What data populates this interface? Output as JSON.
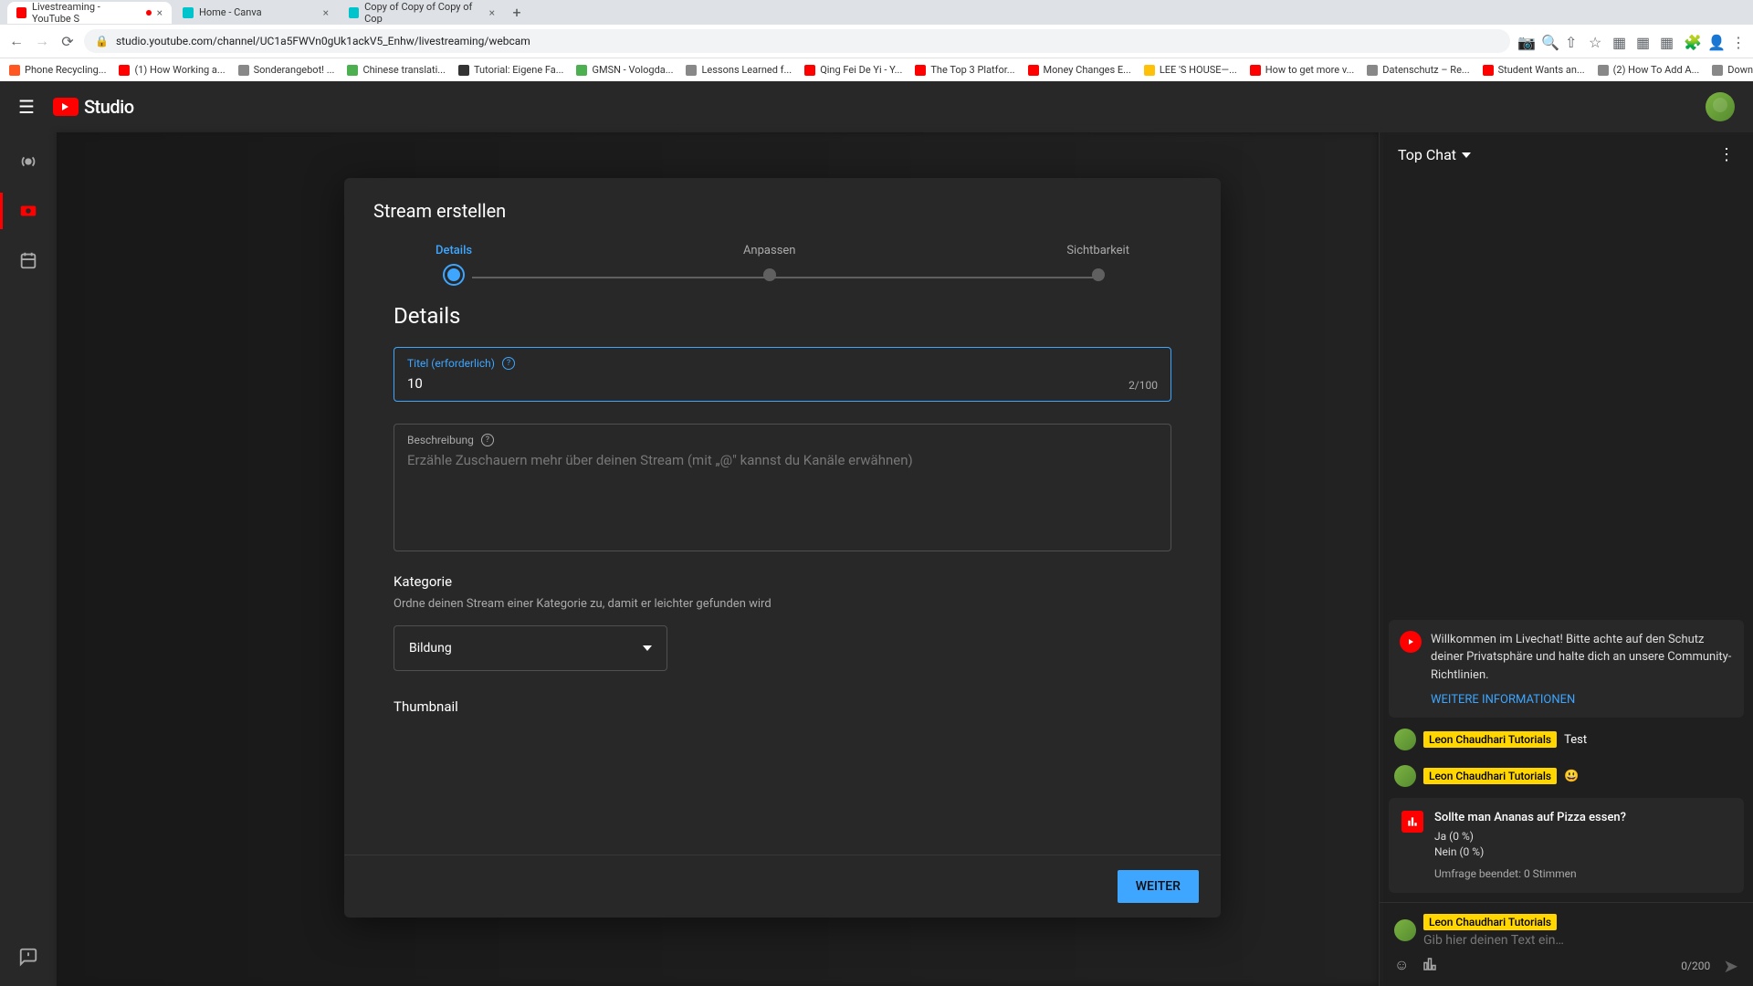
{
  "browser": {
    "tabs": [
      {
        "title": "Livestreaming - YouTube S",
        "favicon": "#f00"
      },
      {
        "title": "Home - Canva",
        "favicon": "#00c4cc"
      },
      {
        "title": "Copy of Copy of Copy of Cop",
        "favicon": "#00c4cc"
      }
    ],
    "url": "studio.youtube.com/channel/UC1a5FWVn0gUk1ackV5_Enhw/livestreaming/webcam"
  },
  "bookmarks": [
    "Phone Recycling...",
    "(1) How Working a...",
    "Sonderangebot! ...",
    "Chinese translati...",
    "Tutorial: Eigene Fa...",
    "GMSN - Vologda...",
    "Lessons Learned f...",
    "Qing Fei De Yi - Y...",
    "The Top 3 Platfor...",
    "Money Changes E...",
    "LEE 'S HOUSE—...",
    "How to get more v...",
    "Datenschutz – Re...",
    "Student Wants an...",
    "(2) How To Add A...",
    "Download - Cooki..."
  ],
  "studio": {
    "logo": "Studio"
  },
  "modal": {
    "title": "Stream erstellen",
    "steps": [
      "Details",
      "Anpassen",
      "Sichtbarkeit"
    ],
    "section_heading": "Details",
    "title_field_label": "Titel (erforderlich)",
    "title_value": "10",
    "title_count": "2/100",
    "desc_label": "Beschreibung",
    "desc_placeholder": "Erzähle Zuschauern mehr über deinen Stream (mit „@\" kannst du Kanäle erwähnen)",
    "category_label": "Kategorie",
    "category_desc": "Ordne deinen Stream einer Kategorie zu, damit er leichter gefunden wird",
    "category_value": "Bildung",
    "thumbnail_label": "Thumbnail",
    "next_button": "WEITER"
  },
  "chat": {
    "header": "Top Chat",
    "welcome": "Willkommen im Livechat! Bitte achte auf den Schutz deiner Privatsphäre und halte dich an unsere Community-Richtlinien.",
    "welcome_link": "WEITERE INFORMATIONEN",
    "author": "Leon Chaudhari Tutorials",
    "msg1": "Test",
    "msg2": "😃",
    "poll": {
      "question": "Sollte man Ananas auf Pizza essen?",
      "opt1": "Ja (0 %)",
      "opt2": "Nein (0 %)",
      "ended": "Umfrage beendet: 0 Stimmen"
    },
    "input_placeholder": "Gib hier deinen Text ein…",
    "count": "0/200"
  }
}
